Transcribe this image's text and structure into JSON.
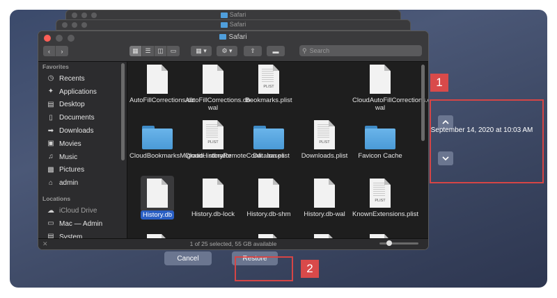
{
  "ghost_windows": [
    {
      "title": "Safari"
    },
    {
      "title": "Safari"
    }
  ],
  "finder": {
    "title": "Safari",
    "search_placeholder": "Search",
    "sidebar": {
      "favorites_header": "Favorites",
      "favorites": [
        {
          "label": "Recents",
          "icon": "clock-icon"
        },
        {
          "label": "Applications",
          "icon": "applications-icon"
        },
        {
          "label": "Desktop",
          "icon": "desktop-icon"
        },
        {
          "label": "Documents",
          "icon": "document-icon"
        },
        {
          "label": "Downloads",
          "icon": "download-icon"
        },
        {
          "label": "Movies",
          "icon": "film-icon"
        },
        {
          "label": "Music",
          "icon": "music-icon"
        },
        {
          "label": "Pictures",
          "icon": "folder-icon"
        },
        {
          "label": "admin",
          "icon": "home-icon"
        }
      ],
      "locations_header": "Locations",
      "locations": [
        {
          "label": "iCloud Drive",
          "icon": "cloud-icon"
        },
        {
          "label": "Mac — Admin",
          "icon": "computer-icon"
        },
        {
          "label": "System",
          "icon": "disk-icon"
        }
      ]
    },
    "files": [
      {
        "name": "AutoFillCorrections.db",
        "kind": "doc",
        "tag": ""
      },
      {
        "name": "AutoFillCorrections.db-wal",
        "kind": "doc",
        "tag": ""
      },
      {
        "name": "Bookmarks.plist",
        "kind": "doc",
        "tag": "PLIST"
      },
      {
        "name": "",
        "kind": "empty",
        "tag": ""
      },
      {
        "name": "CloudAutoFillCorrections.db-wal",
        "kind": "doc",
        "tag": ""
      },
      {
        "name": "CloudBookmarksMigratio...rdinator",
        "kind": "folder",
        "tag": ""
      },
      {
        "name": "CloudHistoryRemoteConfi...ion.plist",
        "kind": "doc",
        "tag": "PLIST"
      },
      {
        "name": "Databases",
        "kind": "folder",
        "tag": ""
      },
      {
        "name": "Downloads.plist",
        "kind": "doc",
        "tag": "PLIST"
      },
      {
        "name": "Favicon Cache",
        "kind": "folder",
        "tag": ""
      },
      {
        "name": "History.db",
        "kind": "doc",
        "tag": "",
        "selected": true
      },
      {
        "name": "History.db-lock",
        "kind": "doc",
        "tag": ""
      },
      {
        "name": "History.db-shm",
        "kind": "doc",
        "tag": ""
      },
      {
        "name": "History.db-wal",
        "kind": "doc",
        "tag": ""
      },
      {
        "name": "KnownExtensions.plist",
        "kind": "doc",
        "tag": "PLIST"
      }
    ],
    "status": "1 of 25 selected, 55 GB available"
  },
  "buttons": {
    "cancel": "Cancel",
    "restore": "Restore"
  },
  "time_machine": {
    "date": "September 14, 2020 at 10:03 AM"
  },
  "badges": {
    "one": "1",
    "two": "2"
  },
  "colors": {
    "highlight_red": "#d64545",
    "selection_blue": "#2a5fc4",
    "button_slate": "#6b7690"
  }
}
